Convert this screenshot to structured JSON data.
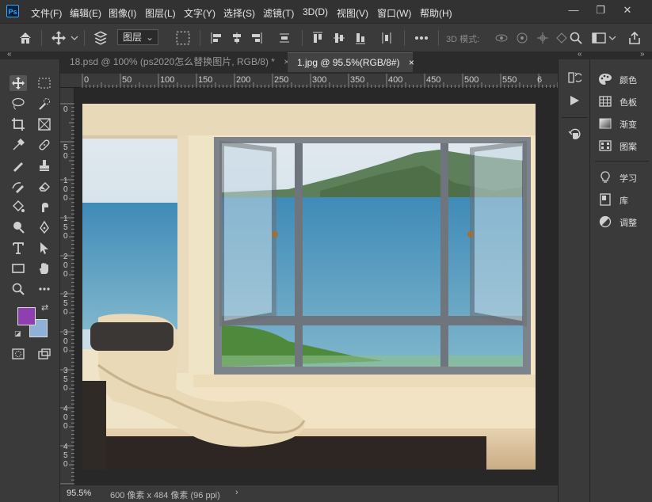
{
  "app": {
    "logo_text": "Ps"
  },
  "menu": [
    "文件(F)",
    "编辑(E)",
    "图像(I)",
    "图层(L)",
    "文字(Y)",
    "选择(S)",
    "滤镜(T)",
    "3D(D)",
    "视图(V)",
    "窗口(W)",
    "帮助(H)"
  ],
  "window_controls": {
    "minimize": "—",
    "restore": "❐",
    "close": "✕"
  },
  "options_bar": {
    "layer_select_value": "图层",
    "mode_3d_label": "3D 模式:"
  },
  "tabs": [
    {
      "label": "18.psd @ 100% (ps2020怎么替换图片, RGB/8) *",
      "close": "×",
      "active": false
    },
    {
      "label": "1.jpg @ 95.5%(RGB/8#)",
      "close": "×",
      "active": true
    }
  ],
  "ruler_top_labels": [
    "0",
    "50",
    "100",
    "150",
    "200",
    "250",
    "300",
    "350",
    "400",
    "450",
    "500",
    "550",
    "6"
  ],
  "ruler_left_labels": [
    "0",
    "5\n0",
    "1\n0\n0",
    "1\n5\n0",
    "2\n0\n0",
    "2\n5\n0",
    "3\n0\n0",
    "3\n5\n0",
    "4\n0\n0",
    "4\n5\n0"
  ],
  "status": {
    "zoom": "95.5%",
    "doc_info": "600 像素 x 484 像素 (96 ppi)",
    "arrow": "›"
  },
  "panels": [
    {
      "label": "颜色",
      "icon": "palette-icon"
    },
    {
      "label": "色板",
      "icon": "swatches-icon"
    },
    {
      "label": "渐变",
      "icon": "gradient-icon"
    },
    {
      "label": "图案",
      "icon": "pattern-icon"
    },
    {
      "label": "学习",
      "icon": "lightbulb-icon"
    },
    {
      "label": "库",
      "icon": "library-icon"
    },
    {
      "label": "调整",
      "icon": "adjustments-icon"
    }
  ],
  "colors": {
    "foreground": "#8e3fb0",
    "background": "#8fb0d8",
    "accent": "#31a8ff"
  }
}
